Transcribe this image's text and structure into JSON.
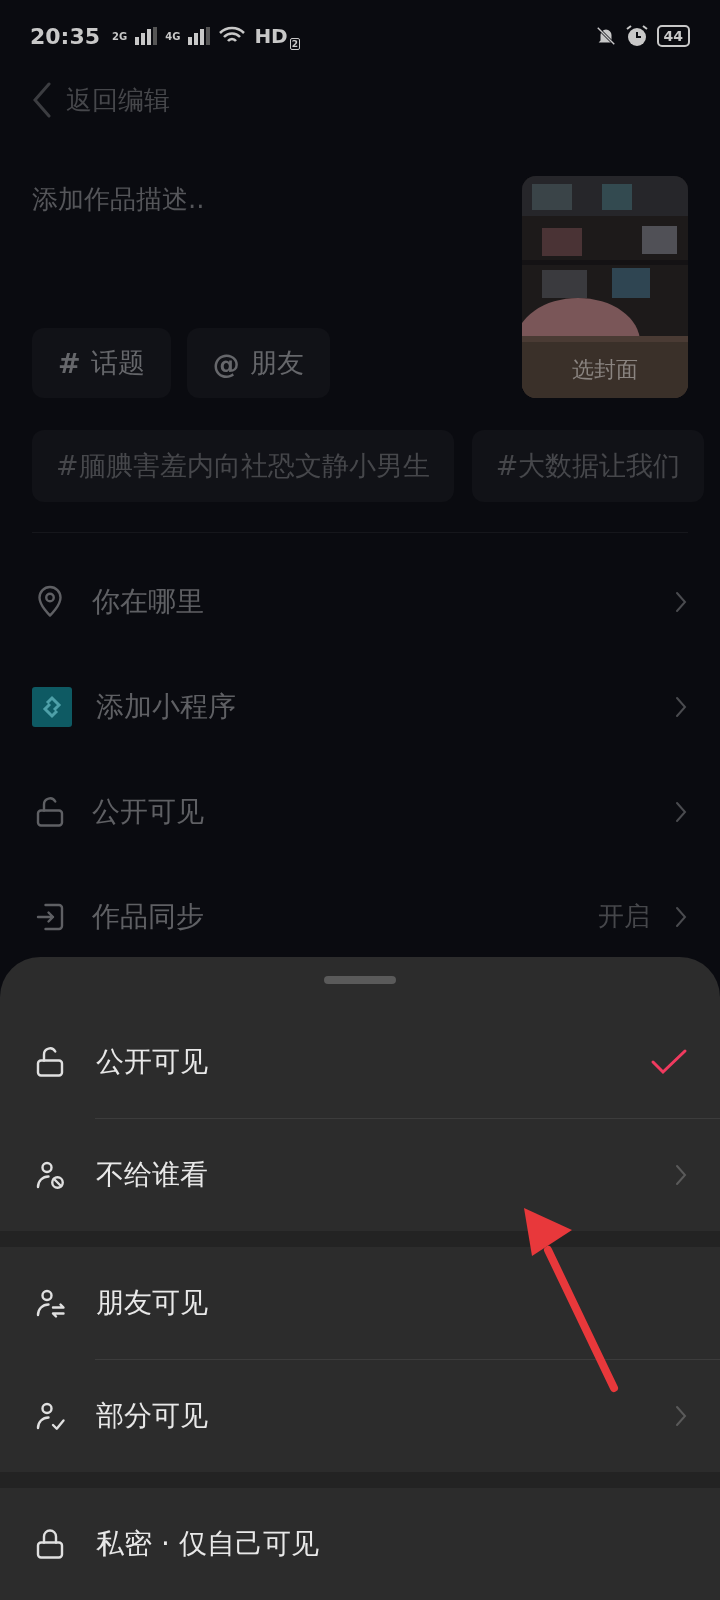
{
  "status_bar": {
    "time": "20:35",
    "sim1": "2G",
    "sim2": "4G",
    "hd": "HD",
    "hd_index": "2",
    "battery": "44"
  },
  "header": {
    "back_label": "返回编辑"
  },
  "description": {
    "placeholder": "添加作品描述.."
  },
  "cover": {
    "kind": "picture",
    "label": "选封面"
  },
  "chips": [
    {
      "symbol": "#",
      "label": "话题"
    },
    {
      "symbol": "@",
      "label": "朋友"
    }
  ],
  "hashtags": [
    "#腼腆害羞内向社恐文静小男生",
    "#大数据让我们"
  ],
  "settings": [
    {
      "kind": "location",
      "label": "你在哪里"
    },
    {
      "kind": "mini_program",
      "label": "添加小程序"
    },
    {
      "kind": "unlocked",
      "label": "公开可见"
    },
    {
      "kind": "sync",
      "label": "作品同步",
      "value": "开启"
    }
  ],
  "sheet": {
    "groups": [
      {
        "options": [
          {
            "kind": "unlocked",
            "label": "公开可见",
            "selected": true,
            "chevron": false
          },
          {
            "kind": "user_block",
            "label": "不给谁看",
            "selected": false,
            "chevron": true
          }
        ]
      },
      {
        "options": [
          {
            "kind": "user_swap",
            "label": "朋友可见",
            "selected": false,
            "chevron": false
          },
          {
            "kind": "user_check",
            "label": "部分可见",
            "selected": false,
            "chevron": true
          }
        ]
      },
      {
        "options": [
          {
            "kind": "locked",
            "label": "私密 · 仅自己可见",
            "selected": false,
            "chevron": false
          }
        ]
      }
    ]
  }
}
